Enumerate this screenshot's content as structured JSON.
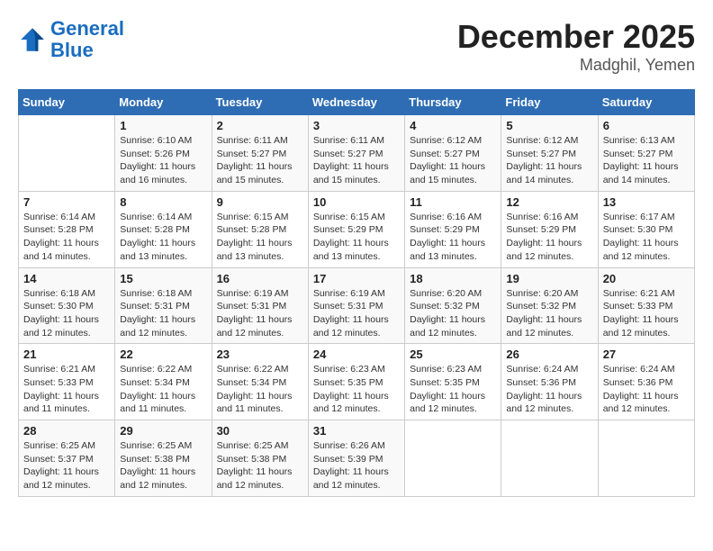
{
  "header": {
    "logo_line1": "General",
    "logo_line2": "Blue",
    "month": "December 2025",
    "location": "Madghil, Yemen"
  },
  "days_of_week": [
    "Sunday",
    "Monday",
    "Tuesday",
    "Wednesday",
    "Thursday",
    "Friday",
    "Saturday"
  ],
  "weeks": [
    [
      {
        "day": "",
        "info": ""
      },
      {
        "day": "1",
        "info": "Sunrise: 6:10 AM\nSunset: 5:26 PM\nDaylight: 11 hours\nand 16 minutes."
      },
      {
        "day": "2",
        "info": "Sunrise: 6:11 AM\nSunset: 5:27 PM\nDaylight: 11 hours\nand 15 minutes."
      },
      {
        "day": "3",
        "info": "Sunrise: 6:11 AM\nSunset: 5:27 PM\nDaylight: 11 hours\nand 15 minutes."
      },
      {
        "day": "4",
        "info": "Sunrise: 6:12 AM\nSunset: 5:27 PM\nDaylight: 11 hours\nand 15 minutes."
      },
      {
        "day": "5",
        "info": "Sunrise: 6:12 AM\nSunset: 5:27 PM\nDaylight: 11 hours\nand 14 minutes."
      },
      {
        "day": "6",
        "info": "Sunrise: 6:13 AM\nSunset: 5:27 PM\nDaylight: 11 hours\nand 14 minutes."
      }
    ],
    [
      {
        "day": "7",
        "info": "Sunrise: 6:14 AM\nSunset: 5:28 PM\nDaylight: 11 hours\nand 14 minutes."
      },
      {
        "day": "8",
        "info": "Sunrise: 6:14 AM\nSunset: 5:28 PM\nDaylight: 11 hours\nand 13 minutes."
      },
      {
        "day": "9",
        "info": "Sunrise: 6:15 AM\nSunset: 5:28 PM\nDaylight: 11 hours\nand 13 minutes."
      },
      {
        "day": "10",
        "info": "Sunrise: 6:15 AM\nSunset: 5:29 PM\nDaylight: 11 hours\nand 13 minutes."
      },
      {
        "day": "11",
        "info": "Sunrise: 6:16 AM\nSunset: 5:29 PM\nDaylight: 11 hours\nand 13 minutes."
      },
      {
        "day": "12",
        "info": "Sunrise: 6:16 AM\nSunset: 5:29 PM\nDaylight: 11 hours\nand 12 minutes."
      },
      {
        "day": "13",
        "info": "Sunrise: 6:17 AM\nSunset: 5:30 PM\nDaylight: 11 hours\nand 12 minutes."
      }
    ],
    [
      {
        "day": "14",
        "info": "Sunrise: 6:18 AM\nSunset: 5:30 PM\nDaylight: 11 hours\nand 12 minutes."
      },
      {
        "day": "15",
        "info": "Sunrise: 6:18 AM\nSunset: 5:31 PM\nDaylight: 11 hours\nand 12 minutes."
      },
      {
        "day": "16",
        "info": "Sunrise: 6:19 AM\nSunset: 5:31 PM\nDaylight: 11 hours\nand 12 minutes."
      },
      {
        "day": "17",
        "info": "Sunrise: 6:19 AM\nSunset: 5:31 PM\nDaylight: 11 hours\nand 12 minutes."
      },
      {
        "day": "18",
        "info": "Sunrise: 6:20 AM\nSunset: 5:32 PM\nDaylight: 11 hours\nand 12 minutes."
      },
      {
        "day": "19",
        "info": "Sunrise: 6:20 AM\nSunset: 5:32 PM\nDaylight: 11 hours\nand 12 minutes."
      },
      {
        "day": "20",
        "info": "Sunrise: 6:21 AM\nSunset: 5:33 PM\nDaylight: 11 hours\nand 12 minutes."
      }
    ],
    [
      {
        "day": "21",
        "info": "Sunrise: 6:21 AM\nSunset: 5:33 PM\nDaylight: 11 hours\nand 11 minutes."
      },
      {
        "day": "22",
        "info": "Sunrise: 6:22 AM\nSunset: 5:34 PM\nDaylight: 11 hours\nand 11 minutes."
      },
      {
        "day": "23",
        "info": "Sunrise: 6:22 AM\nSunset: 5:34 PM\nDaylight: 11 hours\nand 11 minutes."
      },
      {
        "day": "24",
        "info": "Sunrise: 6:23 AM\nSunset: 5:35 PM\nDaylight: 11 hours\nand 12 minutes."
      },
      {
        "day": "25",
        "info": "Sunrise: 6:23 AM\nSunset: 5:35 PM\nDaylight: 11 hours\nand 12 minutes."
      },
      {
        "day": "26",
        "info": "Sunrise: 6:24 AM\nSunset: 5:36 PM\nDaylight: 11 hours\nand 12 minutes."
      },
      {
        "day": "27",
        "info": "Sunrise: 6:24 AM\nSunset: 5:36 PM\nDaylight: 11 hours\nand 12 minutes."
      }
    ],
    [
      {
        "day": "28",
        "info": "Sunrise: 6:25 AM\nSunset: 5:37 PM\nDaylight: 11 hours\nand 12 minutes."
      },
      {
        "day": "29",
        "info": "Sunrise: 6:25 AM\nSunset: 5:38 PM\nDaylight: 11 hours\nand 12 minutes."
      },
      {
        "day": "30",
        "info": "Sunrise: 6:25 AM\nSunset: 5:38 PM\nDaylight: 11 hours\nand 12 minutes."
      },
      {
        "day": "31",
        "info": "Sunrise: 6:26 AM\nSunset: 5:39 PM\nDaylight: 11 hours\nand 12 minutes."
      },
      {
        "day": "",
        "info": ""
      },
      {
        "day": "",
        "info": ""
      },
      {
        "day": "",
        "info": ""
      }
    ]
  ]
}
